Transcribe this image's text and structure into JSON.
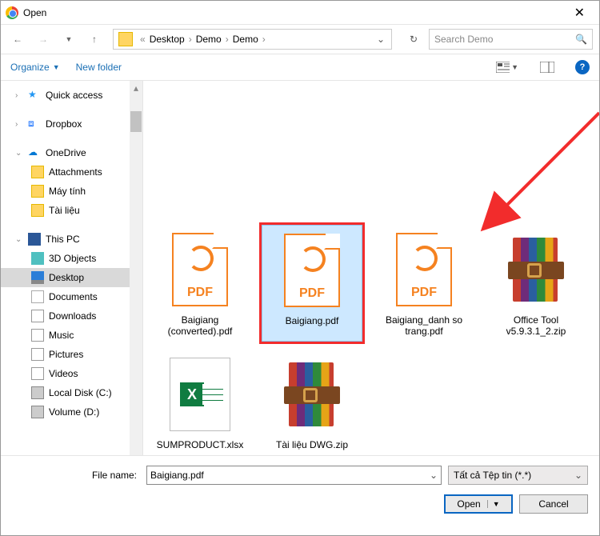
{
  "window": {
    "title": "Open"
  },
  "breadcrumb": {
    "prefix": "«",
    "parts": [
      "Desktop",
      "Demo",
      "Demo"
    ]
  },
  "search": {
    "placeholder": "Search Demo"
  },
  "toolbar": {
    "organize": "Organize",
    "newfolder": "New folder"
  },
  "sidebar": {
    "quick_access": "Quick access",
    "dropbox": "Dropbox",
    "onedrive": "OneDrive",
    "onedrive_children": [
      "Attachments",
      "Máy tính",
      "Tài liệu"
    ],
    "thispc": "This PC",
    "thispc_children": [
      "3D Objects",
      "Desktop",
      "Documents",
      "Downloads",
      "Music",
      "Pictures",
      "Videos",
      "Local Disk (C:)",
      "Volume (D:)"
    ]
  },
  "files": [
    {
      "name": "Baigiang (converted).pdf",
      "type": "pdf"
    },
    {
      "name": "Baigiang.pdf",
      "type": "pdf",
      "selected": true
    },
    {
      "name": "Baigiang_danh so trang.pdf",
      "type": "pdf"
    },
    {
      "name": "Office Tool v5.9.3.1_2.zip",
      "type": "zip"
    },
    {
      "name": "SUMPRODUCT.xlsx",
      "type": "xlsx"
    },
    {
      "name": "Tài liệu DWG.zip",
      "type": "zip"
    }
  ],
  "footer": {
    "filename_label": "File name:",
    "filename_value": "Baigiang.pdf",
    "filter": "Tất cả Tệp tin (*.*)",
    "open": "Open",
    "cancel": "Cancel"
  }
}
